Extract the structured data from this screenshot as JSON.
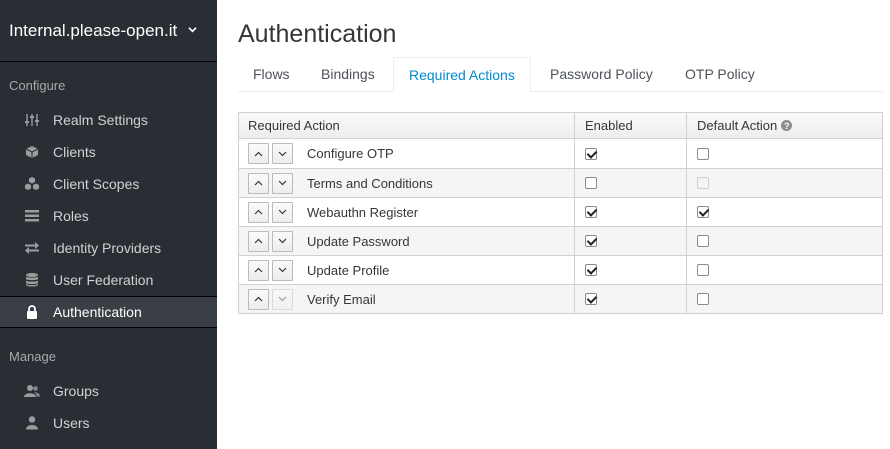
{
  "sidebar": {
    "realm_name": "Internal.please-open.it",
    "configure_title": "Configure",
    "configure_items": [
      {
        "label": "Realm Settings",
        "icon": "sliders-icon"
      },
      {
        "label": "Clients",
        "icon": "cube-icon"
      },
      {
        "label": "Client Scopes",
        "icon": "cubes-icon"
      },
      {
        "label": "Roles",
        "icon": "list-icon"
      },
      {
        "label": "Identity Providers",
        "icon": "exchange-icon"
      },
      {
        "label": "User Federation",
        "icon": "database-icon"
      },
      {
        "label": "Authentication",
        "icon": "lock-icon",
        "active": true
      }
    ],
    "manage_title": "Manage",
    "manage_items": [
      {
        "label": "Groups",
        "icon": "users-icon"
      },
      {
        "label": "Users",
        "icon": "user-icon"
      }
    ]
  },
  "main": {
    "title": "Authentication",
    "tabs": [
      {
        "label": "Flows"
      },
      {
        "label": "Bindings"
      },
      {
        "label": "Required Actions",
        "active": true
      },
      {
        "label": "Password Policy"
      },
      {
        "label": "OTP Policy"
      }
    ],
    "table": {
      "headers": {
        "required_action": "Required Action",
        "enabled": "Enabled",
        "default_action": "Default Action"
      },
      "rows": [
        {
          "name": "Configure OTP",
          "enabled": true,
          "default": false,
          "default_disabled": false,
          "up_disabled": false,
          "down_disabled": false
        },
        {
          "name": "Terms and Conditions",
          "enabled": false,
          "default": false,
          "default_disabled": true,
          "up_disabled": false,
          "down_disabled": false
        },
        {
          "name": "Webauthn Register",
          "enabled": true,
          "default": true,
          "default_disabled": false,
          "up_disabled": false,
          "down_disabled": false
        },
        {
          "name": "Update Password",
          "enabled": true,
          "default": false,
          "default_disabled": false,
          "up_disabled": false,
          "down_disabled": false
        },
        {
          "name": "Update Profile",
          "enabled": true,
          "default": false,
          "default_disabled": false,
          "up_disabled": false,
          "down_disabled": false
        },
        {
          "name": "Verify Email",
          "enabled": true,
          "default": false,
          "default_disabled": false,
          "up_disabled": false,
          "down_disabled": true
        }
      ]
    }
  },
  "colors": {
    "sidebar_bg": "#292e34",
    "accent": "#0088ce"
  }
}
